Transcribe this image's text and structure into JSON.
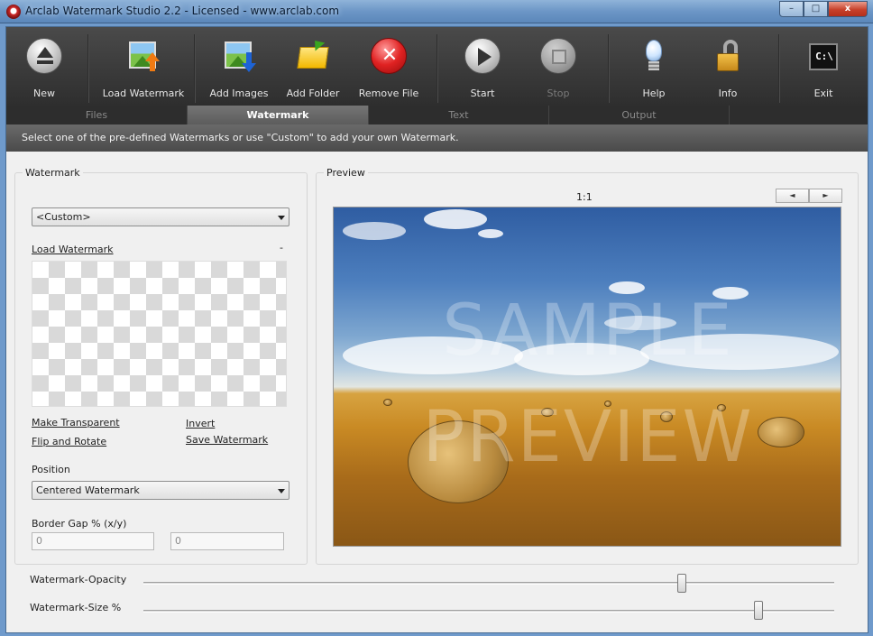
{
  "window": {
    "title": "Arclab Watermark Studio 2.2 - Licensed - www.arclab.com",
    "minimize": "–",
    "maximize": "□",
    "close": "x"
  },
  "toolbar": {
    "new": "New",
    "load_watermark": "Load Watermark",
    "add_images": "Add Images",
    "add_folder": "Add Folder",
    "remove_file": "Remove File",
    "start": "Start",
    "stop": "Stop",
    "help": "Help",
    "info": "Info",
    "exit": "Exit"
  },
  "tabs": {
    "files": "Files",
    "watermark": "Watermark",
    "text": "Text",
    "output": "Output",
    "active": "watermark"
  },
  "hint": "Select one of the pre-defined Watermarks or use \"Custom\" to add your own Watermark.",
  "watermark_panel": {
    "title": "Watermark",
    "preset_value": "<Custom>",
    "load_link": "Load Watermark",
    "load_status": "-",
    "make_transparent": "Make Transparent",
    "invert": "Invert",
    "flip_rotate": "Flip and Rotate",
    "save_watermark": "Save Watermark",
    "position_label": "Position",
    "position_value": "Centered Watermark",
    "border_gap_label": "Border Gap % (x/y)",
    "border_gap_x": "0",
    "border_gap_y": "0"
  },
  "preview_panel": {
    "title": "Preview",
    "zoom": "1:1",
    "prev": "◄",
    "next": "►",
    "watermark_line1": "SAMPLE",
    "watermark_line2": "PREVIEW"
  },
  "sliders": {
    "opacity_label": "Watermark-Opacity",
    "opacity_value": 0.78,
    "size_label": "Watermark-Size %",
    "size_value": 0.89
  },
  "colors": {
    "toolbar_bg": "#3a3a3a",
    "active_tab": "#656565",
    "title_bar": "#6c96c6"
  }
}
